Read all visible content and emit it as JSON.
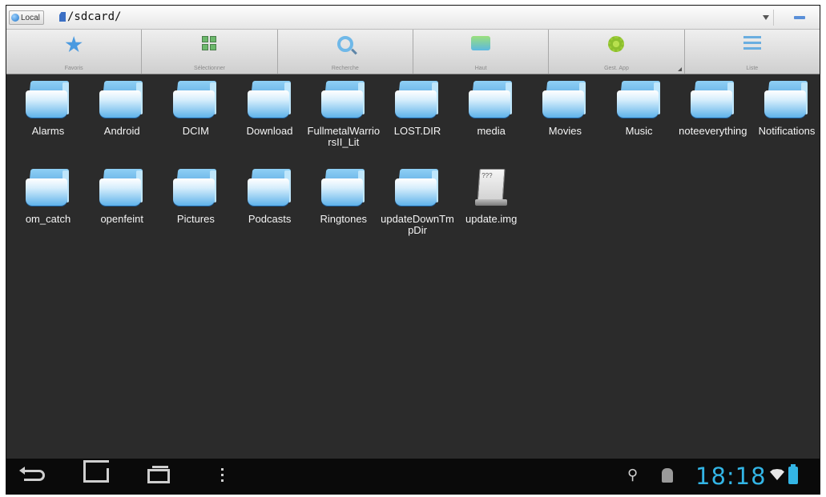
{
  "addressbar": {
    "location_label": "Local",
    "path": "/sdcard/"
  },
  "toolbar": {
    "items": [
      {
        "label": "Favoris",
        "icon": "star-icon"
      },
      {
        "label": "Sélectionner",
        "icon": "select-grid-icon"
      },
      {
        "label": "Recherche",
        "icon": "search-icon"
      },
      {
        "label": "Haut",
        "icon": "up-folder-icon"
      },
      {
        "label": "Gest. App",
        "icon": "gear-app-icon"
      },
      {
        "label": "Liste",
        "icon": "list-view-icon"
      }
    ]
  },
  "files": [
    {
      "name": "Alarms",
      "type": "folder"
    },
    {
      "name": "Android",
      "type": "folder"
    },
    {
      "name": "DCIM",
      "type": "folder"
    },
    {
      "name": "Download",
      "type": "folder"
    },
    {
      "name": "FullmetalWarriorsII_Lit",
      "type": "folder"
    },
    {
      "name": "LOST.DIR",
      "type": "folder"
    },
    {
      "name": "media",
      "type": "folder"
    },
    {
      "name": "Movies",
      "type": "folder"
    },
    {
      "name": "Music",
      "type": "folder"
    },
    {
      "name": "noteeverything",
      "type": "folder"
    },
    {
      "name": "Notifications",
      "type": "folder"
    },
    {
      "name": "om_catch",
      "type": "folder"
    },
    {
      "name": "openfeint",
      "type": "folder"
    },
    {
      "name": "Pictures",
      "type": "folder"
    },
    {
      "name": "Podcasts",
      "type": "folder"
    },
    {
      "name": "Ringtones",
      "type": "folder"
    },
    {
      "name": "updateDownTmpDir",
      "type": "folder"
    },
    {
      "name": "update.img",
      "type": "file"
    }
  ],
  "statusbar": {
    "time": "18:18"
  },
  "colors": {
    "background": "#2b2b2b",
    "clock": "#33b5e5",
    "folder": "#3a93dc"
  }
}
